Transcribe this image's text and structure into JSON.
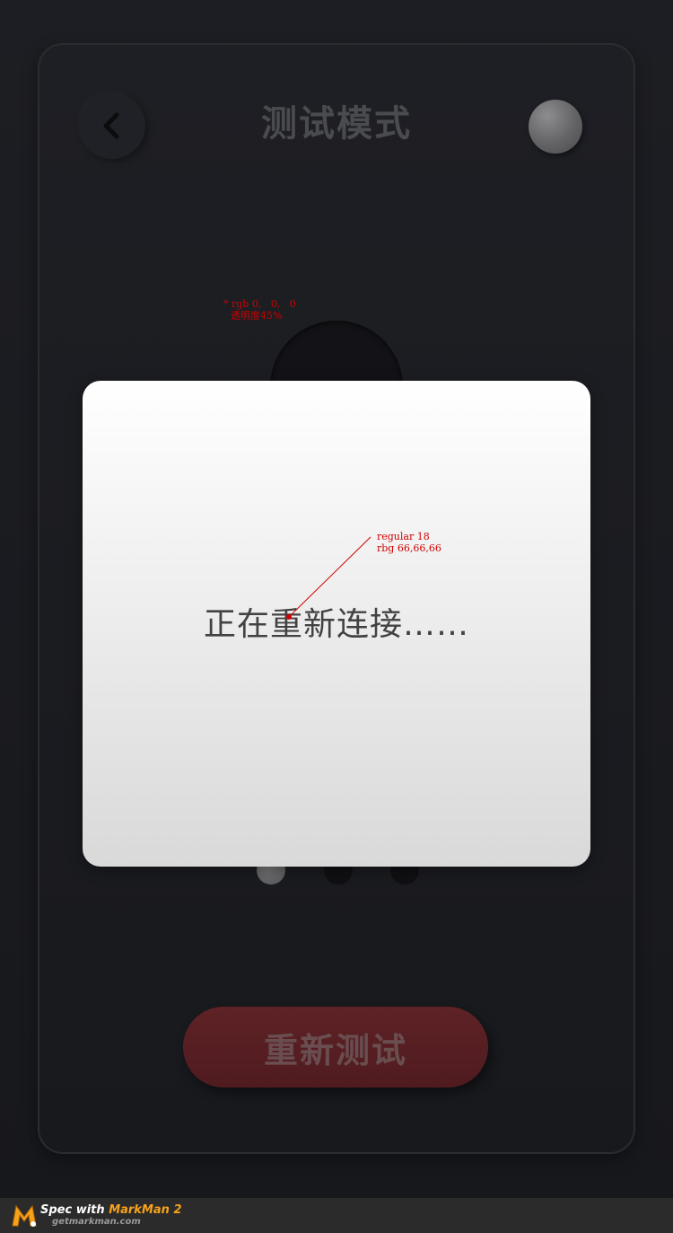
{
  "header": {
    "title": "测试模式",
    "back_icon": "chevron-left-icon",
    "status_icon": "status-dot-icon"
  },
  "annotations": {
    "note1_line1": "* rgb 0,   0,   0",
    "note1_line2": "透明度45%",
    "note2_line1": "regular 18",
    "note2_line2": "rbg 66,66,66",
    "color": "#d10000"
  },
  "modal": {
    "message": "正在重新连接……",
    "text_color": "#424242"
  },
  "pagination": {
    "count": 3,
    "active_index": 0
  },
  "actions": {
    "retest_label": "重新测试",
    "retest_color": "#5a1f23"
  },
  "footer": {
    "spec_prefix": "Spec with ",
    "spec_brand": "MarkMan 2",
    "url": "getmarkman.com",
    "brand_color": "#f7a21b"
  }
}
